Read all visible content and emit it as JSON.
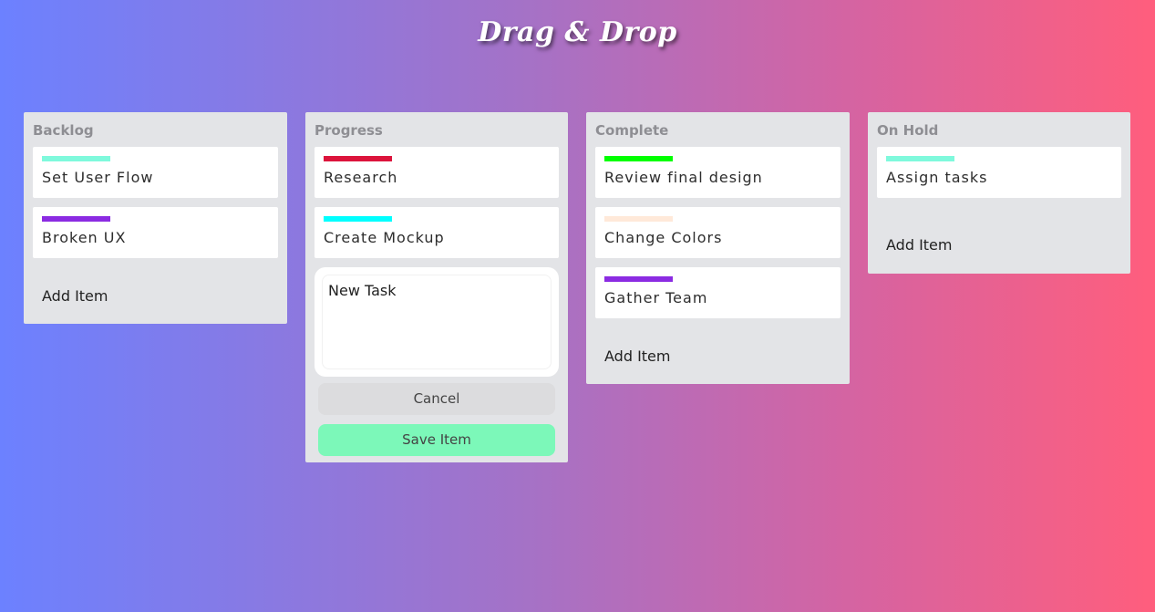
{
  "app": {
    "title": "Drag & Drop"
  },
  "columns": [
    {
      "title": "Backlog",
      "cards": [
        {
          "text": "Set User Flow",
          "color": "#7ff9dc"
        },
        {
          "text": "Broken UX",
          "color": "#8b2be2"
        }
      ],
      "add_label": "Add Item"
    },
    {
      "title": "Progress",
      "cards": [
        {
          "text": "Research",
          "color": "#dc143c"
        },
        {
          "text": "Create Mockup",
          "color": "#00ffff"
        }
      ],
      "new_task": {
        "value": "New Task",
        "cancel_label": "Cancel",
        "save_label": "Save Item"
      }
    },
    {
      "title": "Complete",
      "cards": [
        {
          "text": "Review final design",
          "color": "#00ff00"
        },
        {
          "text": "Change Colors",
          "color": "#ffe9d9"
        },
        {
          "text": "Gather Team",
          "color": "#8b2be2"
        }
      ],
      "add_label": "Add Item"
    },
    {
      "title": "On Hold",
      "cards": [
        {
          "text": "Assign tasks",
          "color": "#7ff9dc"
        }
      ],
      "add_label": "Add Item"
    }
  ]
}
